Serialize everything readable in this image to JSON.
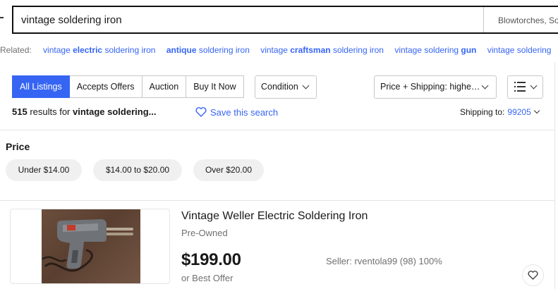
{
  "search": {
    "query": "vintage soldering iron",
    "category": "Blowtorches, So"
  },
  "related": {
    "label": "Related:",
    "links": [
      {
        "pre": "vintage ",
        "bold": "electric",
        "post": " soldering iron"
      },
      {
        "pre": "",
        "bold": "antique",
        "post": " soldering iron"
      },
      {
        "pre": "vintage ",
        "bold": "craftsman",
        "post": " soldering iron"
      },
      {
        "pre": "vintage soldering ",
        "bold": "gun",
        "post": ""
      },
      {
        "pre": "vintage soldering",
        "bold": "",
        "post": ""
      }
    ]
  },
  "filters": {
    "tabs": [
      "All Listings",
      "Accepts Offers",
      "Auction",
      "Buy It Now"
    ],
    "condition_label": "Condition",
    "sort_label": "Price + Shipping: highe…",
    "view_icon": "list-view-icon"
  },
  "results": {
    "count": "515",
    "text": " results for ",
    "query": "vintage soldering...",
    "save_search": "Save this search",
    "shipping_label": "Shipping to:",
    "zip": "99205"
  },
  "price_filter": {
    "heading": "Price",
    "ranges": [
      "Under $14.00",
      "$14.00 to $20.00",
      "Over $20.00"
    ]
  },
  "item": {
    "title": "Vintage Weller Electric Soldering Iron",
    "condition": "Pre-Owned",
    "price": "$199.00",
    "offer": "or Best Offer",
    "seller": "Seller: rventola99 (98) 100%"
  },
  "colors": {
    "accent": "#3665f3",
    "text": "#191919",
    "muted": "#707070",
    "pill": "#f0f0f0"
  }
}
